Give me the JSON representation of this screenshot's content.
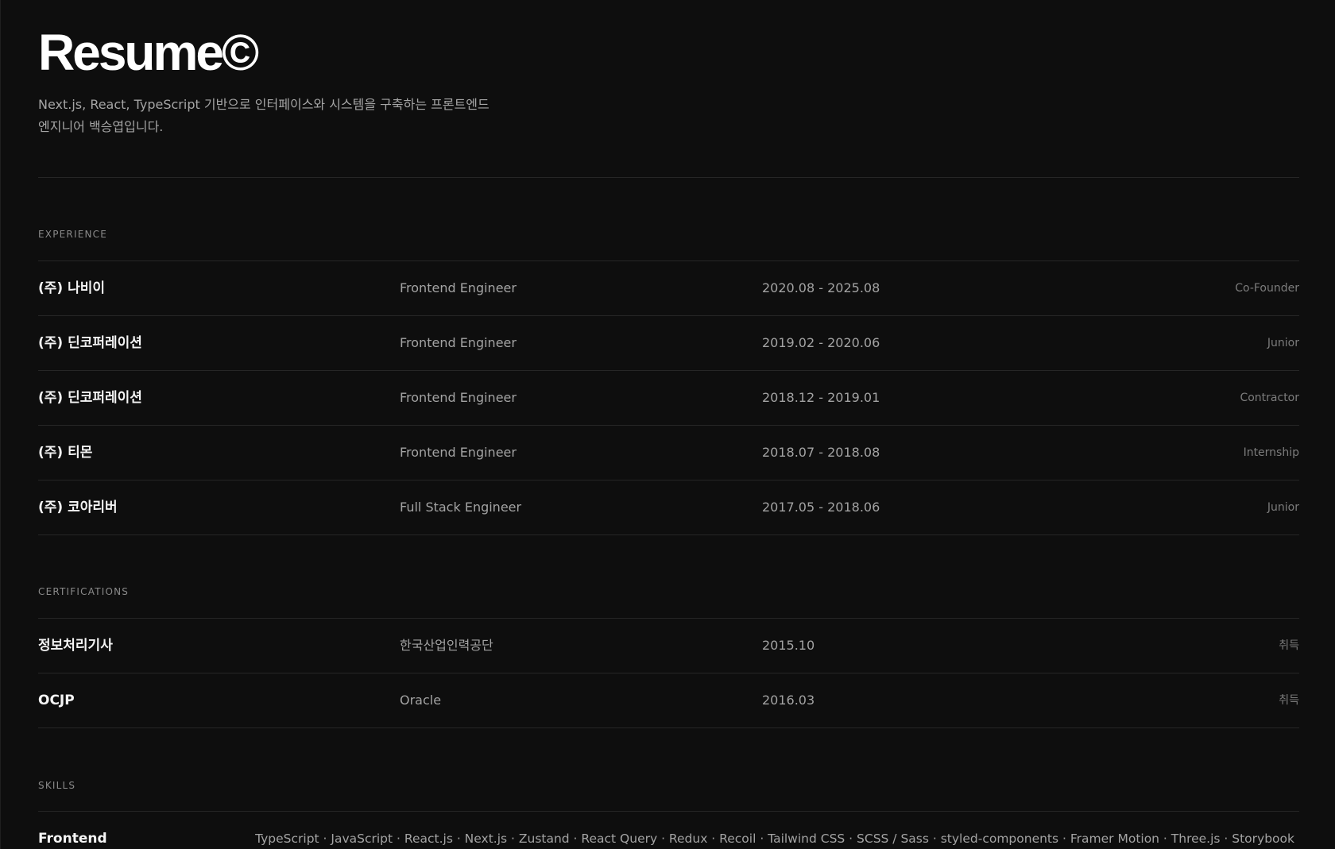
{
  "header": {
    "title": "Resume©",
    "intro": "Next.js, React, TypeScript 기반으로 인터페이스와 시스템을 구축하는 프론트엔드 엔지니어 백승엽입니다."
  },
  "experience": {
    "label": "EXPERIENCE",
    "items": [
      {
        "company": "(주) 나비이",
        "role": "Frontend Engineer",
        "period": "2020.08 - 2025.08",
        "level": "Co-Founder"
      },
      {
        "company": "(주) 딘코퍼레이션",
        "role": "Frontend Engineer",
        "period": "2019.02 - 2020.06",
        "level": "Junior"
      },
      {
        "company": "(주) 딘코퍼레이션",
        "role": "Frontend Engineer",
        "period": "2018.12 - 2019.01",
        "level": "Contractor"
      },
      {
        "company": "(주) 티몬",
        "role": "Frontend Engineer",
        "period": "2018.07 - 2018.08",
        "level": "Internship"
      },
      {
        "company": "(주) 코아리버",
        "role": "Full Stack Engineer",
        "period": "2017.05 - 2018.06",
        "level": "Junior"
      }
    ]
  },
  "certifications": {
    "label": "CERTIFICATIONS",
    "items": [
      {
        "name": "정보처리기사",
        "issuer": "한국산업인력공단",
        "date": "2015.10",
        "status": "취득"
      },
      {
        "name": "OCJP",
        "issuer": "Oracle",
        "date": "2016.03",
        "status": "취득"
      }
    ]
  },
  "skills": {
    "label": "SKILLS",
    "groups": [
      {
        "category": "Frontend",
        "list": "TypeScript · JavaScript · React.js · Next.js · Zustand · React Query · Redux · Recoil · Tailwind CSS · SCSS / Sass · styled-components · Framer Motion · Three.js · Storybook"
      }
    ]
  }
}
